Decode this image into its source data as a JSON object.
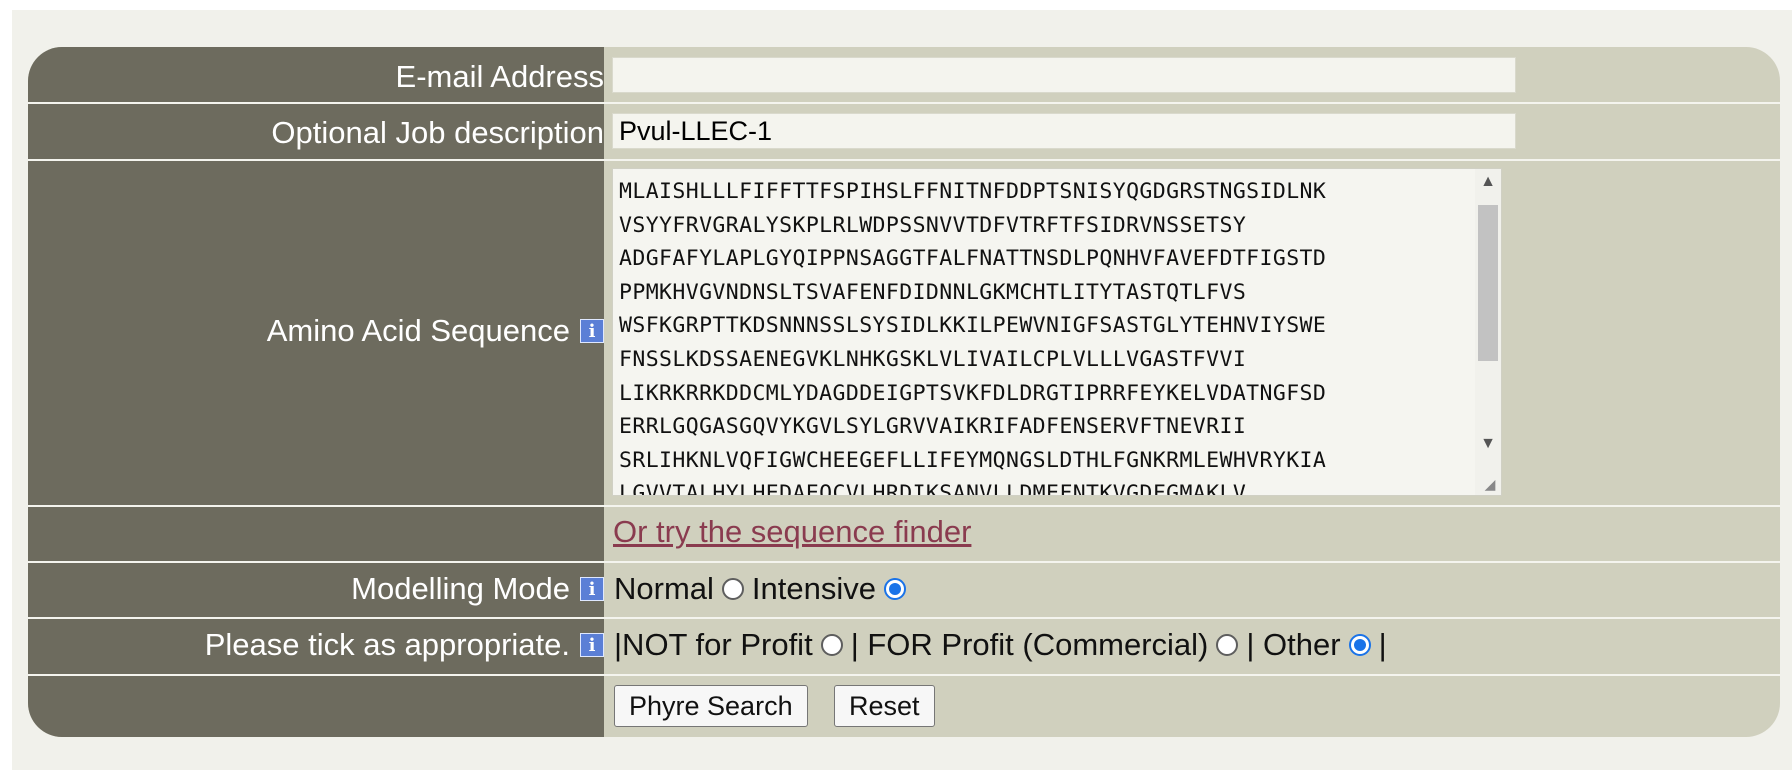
{
  "form": {
    "email": {
      "label": "E-mail Address",
      "value": "",
      "placeholder": ""
    },
    "job_description": {
      "label": "Optional Job description",
      "value": "Pvul-LLEC-1"
    },
    "sequence": {
      "label": "Amino Acid Sequence",
      "lines": [
        "MLAISHLLLFIFFTTFSPIHSLFFNITNFDDPTSNISYQGDGRSTNGSIDLNK",
        "VSYYFRVGRALYSKPLRLWDPSSNVVTDFVTRFTFSIDRVNSSETSY",
        "ADGFAFYLAPLGYQIPPNSAGGTFALFNATTNSDLPQNHVFAVEFDTFIGSTD",
        "PPMKHVGVNDNSLTSVAFENFDIDNNLGKMCHTLITYTASTQTLFVS",
        "WSFKGRPTTKDSNNNSSLSYSIDLKKILPEWVNIGFSASTGLYTEHNVIYSWE",
        "FNSSLKDSSAENEGVKLNHKGSKLVLIVAILCPLVLLLVGASTFVVI",
        "LIKRKRRKDDCMLYDAGDDEIGPTSVKFDLDRGTIPRRFEYKELVDATNGFSD",
        "ERRLGQGASGQVYKGVLSYLGRVVAIKRIFADFENSERVFTNEVRII",
        "SRLIHKNLVQFIGWCHEEGEFLLIFEYMQNGSLDTHLFGNKRMLEWHVRYKIA",
        "LGVVTALHYLHEDAEQCVLHRDIKSANVLLDMEFNTKVGDFGMAKLV"
      ]
    },
    "finder_link": "Or try the sequence finder",
    "modelling_mode": {
      "label": "Modelling Mode",
      "options": [
        "Normal",
        "Intensive"
      ],
      "selected": "Intensive"
    },
    "usage": {
      "label": "Please tick as appropriate.",
      "prefix": "|NOT for Profit",
      "sep1": "| FOR Profit (Commercial)",
      "sep2": "| Other",
      "suffix": "|",
      "selected": "Other"
    },
    "buttons": {
      "search": "Phyre Search",
      "reset": "Reset"
    }
  },
  "colors": {
    "label_column": "#6d6b5e",
    "panel": "#d0d0be",
    "page": "#f1f1eb",
    "link": "#8a3b4f",
    "radio_selected": "#1a73e8"
  },
  "icons": {
    "info": "info-icon"
  }
}
